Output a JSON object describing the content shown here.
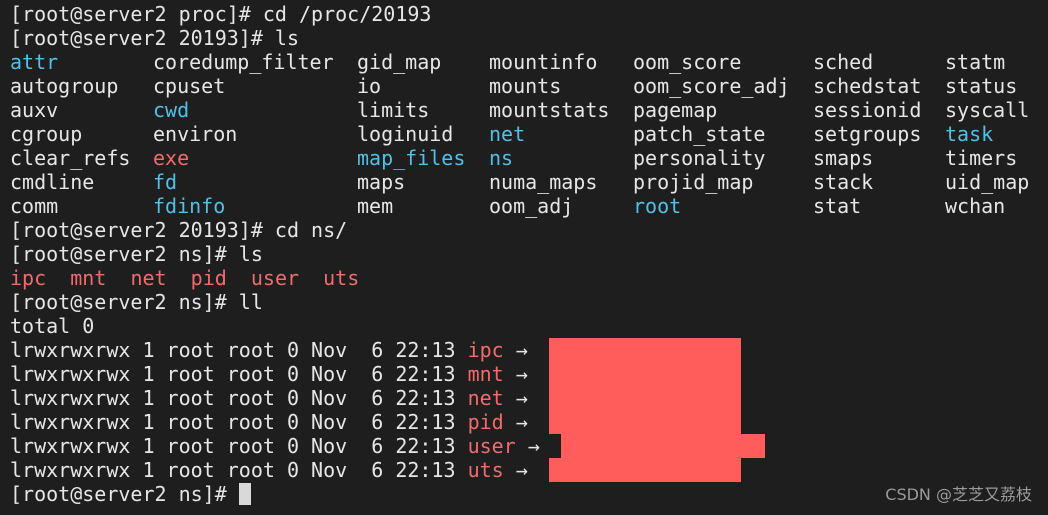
{
  "prompts": {
    "p1": "[root@server2 proc]# ",
    "c1": "cd /proc/20193",
    "p2": "[root@server2 20193]# ",
    "c2": "ls",
    "p3": "[root@server2 20193]# ",
    "c3": "cd ns/",
    "p4": "[root@server2 ns]# ",
    "c4": "ls",
    "p5": "[root@server2 ns]# ",
    "c5": "ll",
    "p6": "[root@server2 ns]# "
  },
  "ls_colors": {
    "dir": "#4fc1e9",
    "link": "#f26b6b",
    "text": "#e6e6e6",
    "redaction": "#ff5c5c"
  },
  "ls_grid": [
    [
      {
        "t": "attr",
        "c": "cyan"
      },
      {
        "t": "coredump_filter",
        "c": "white"
      },
      {
        "t": "gid_map",
        "c": "white"
      },
      {
        "t": "mountinfo",
        "c": "white"
      },
      {
        "t": "oom_score",
        "c": "white"
      },
      {
        "t": "sched",
        "c": "white"
      },
      {
        "t": "statm",
        "c": "white"
      }
    ],
    [
      {
        "t": "autogroup",
        "c": "white"
      },
      {
        "t": "cpuset",
        "c": "white"
      },
      {
        "t": "io",
        "c": "white"
      },
      {
        "t": "mounts",
        "c": "white"
      },
      {
        "t": "oom_score_adj",
        "c": "white"
      },
      {
        "t": "schedstat",
        "c": "white"
      },
      {
        "t": "status",
        "c": "white"
      }
    ],
    [
      {
        "t": "auxv",
        "c": "white"
      },
      {
        "t": "cwd",
        "c": "cyan"
      },
      {
        "t": "limits",
        "c": "white"
      },
      {
        "t": "mountstats",
        "c": "white"
      },
      {
        "t": "pagemap",
        "c": "white"
      },
      {
        "t": "sessionid",
        "c": "white"
      },
      {
        "t": "syscall",
        "c": "white"
      }
    ],
    [
      {
        "t": "cgroup",
        "c": "white"
      },
      {
        "t": "environ",
        "c": "white"
      },
      {
        "t": "loginuid",
        "c": "white"
      },
      {
        "t": "net",
        "c": "cyan"
      },
      {
        "t": "patch_state",
        "c": "white"
      },
      {
        "t": "setgroups",
        "c": "white"
      },
      {
        "t": "task",
        "c": "cyan"
      }
    ],
    [
      {
        "t": "clear_refs",
        "c": "white"
      },
      {
        "t": "exe",
        "c": "red"
      },
      {
        "t": "map_files",
        "c": "cyan"
      },
      {
        "t": "ns",
        "c": "cyan"
      },
      {
        "t": "personality",
        "c": "white"
      },
      {
        "t": "smaps",
        "c": "white"
      },
      {
        "t": "timers",
        "c": "white"
      }
    ],
    [
      {
        "t": "cmdline",
        "c": "white"
      },
      {
        "t": "fd",
        "c": "cyan"
      },
      {
        "t": "maps",
        "c": "white"
      },
      {
        "t": "numa_maps",
        "c": "white"
      },
      {
        "t": "projid_map",
        "c": "white"
      },
      {
        "t": "stack",
        "c": "white"
      },
      {
        "t": "uid_map",
        "c": "white"
      }
    ],
    [
      {
        "t": "comm",
        "c": "white"
      },
      {
        "t": "fdinfo",
        "c": "cyan"
      },
      {
        "t": "mem",
        "c": "white"
      },
      {
        "t": "oom_adj",
        "c": "white"
      },
      {
        "t": "root",
        "c": "cyan"
      },
      {
        "t": "stat",
        "c": "white"
      },
      {
        "t": "wchan",
        "c": "white"
      }
    ]
  ],
  "ns_list": [
    "ipc",
    "mnt",
    "net",
    "pid",
    "user",
    "uts"
  ],
  "total_line": "total 0",
  "ll_rows": [
    {
      "perm": "lrwxrwxrwx 1 root root 0 Nov  6 22:13 ",
      "name": "ipc",
      "arrow": " →"
    },
    {
      "perm": "lrwxrwxrwx 1 root root 0 Nov  6 22:13 ",
      "name": "mnt",
      "arrow": " →"
    },
    {
      "perm": "lrwxrwxrwx 1 root root 0 Nov  6 22:13 ",
      "name": "net",
      "arrow": " →"
    },
    {
      "perm": "lrwxrwxrwx 1 root root 0 Nov  6 22:13 ",
      "name": "pid",
      "arrow": " →"
    },
    {
      "perm": "lrwxrwxrwx 1 root root 0 Nov  6 22:13 ",
      "name": "user",
      "arrow": " →"
    },
    {
      "perm": "lrwxrwxrwx 1 root root 0 Nov  6 22:13 ",
      "name": "uts",
      "arrow": " →"
    }
  ],
  "watermark": "CSDN @芝芝又荔枝"
}
